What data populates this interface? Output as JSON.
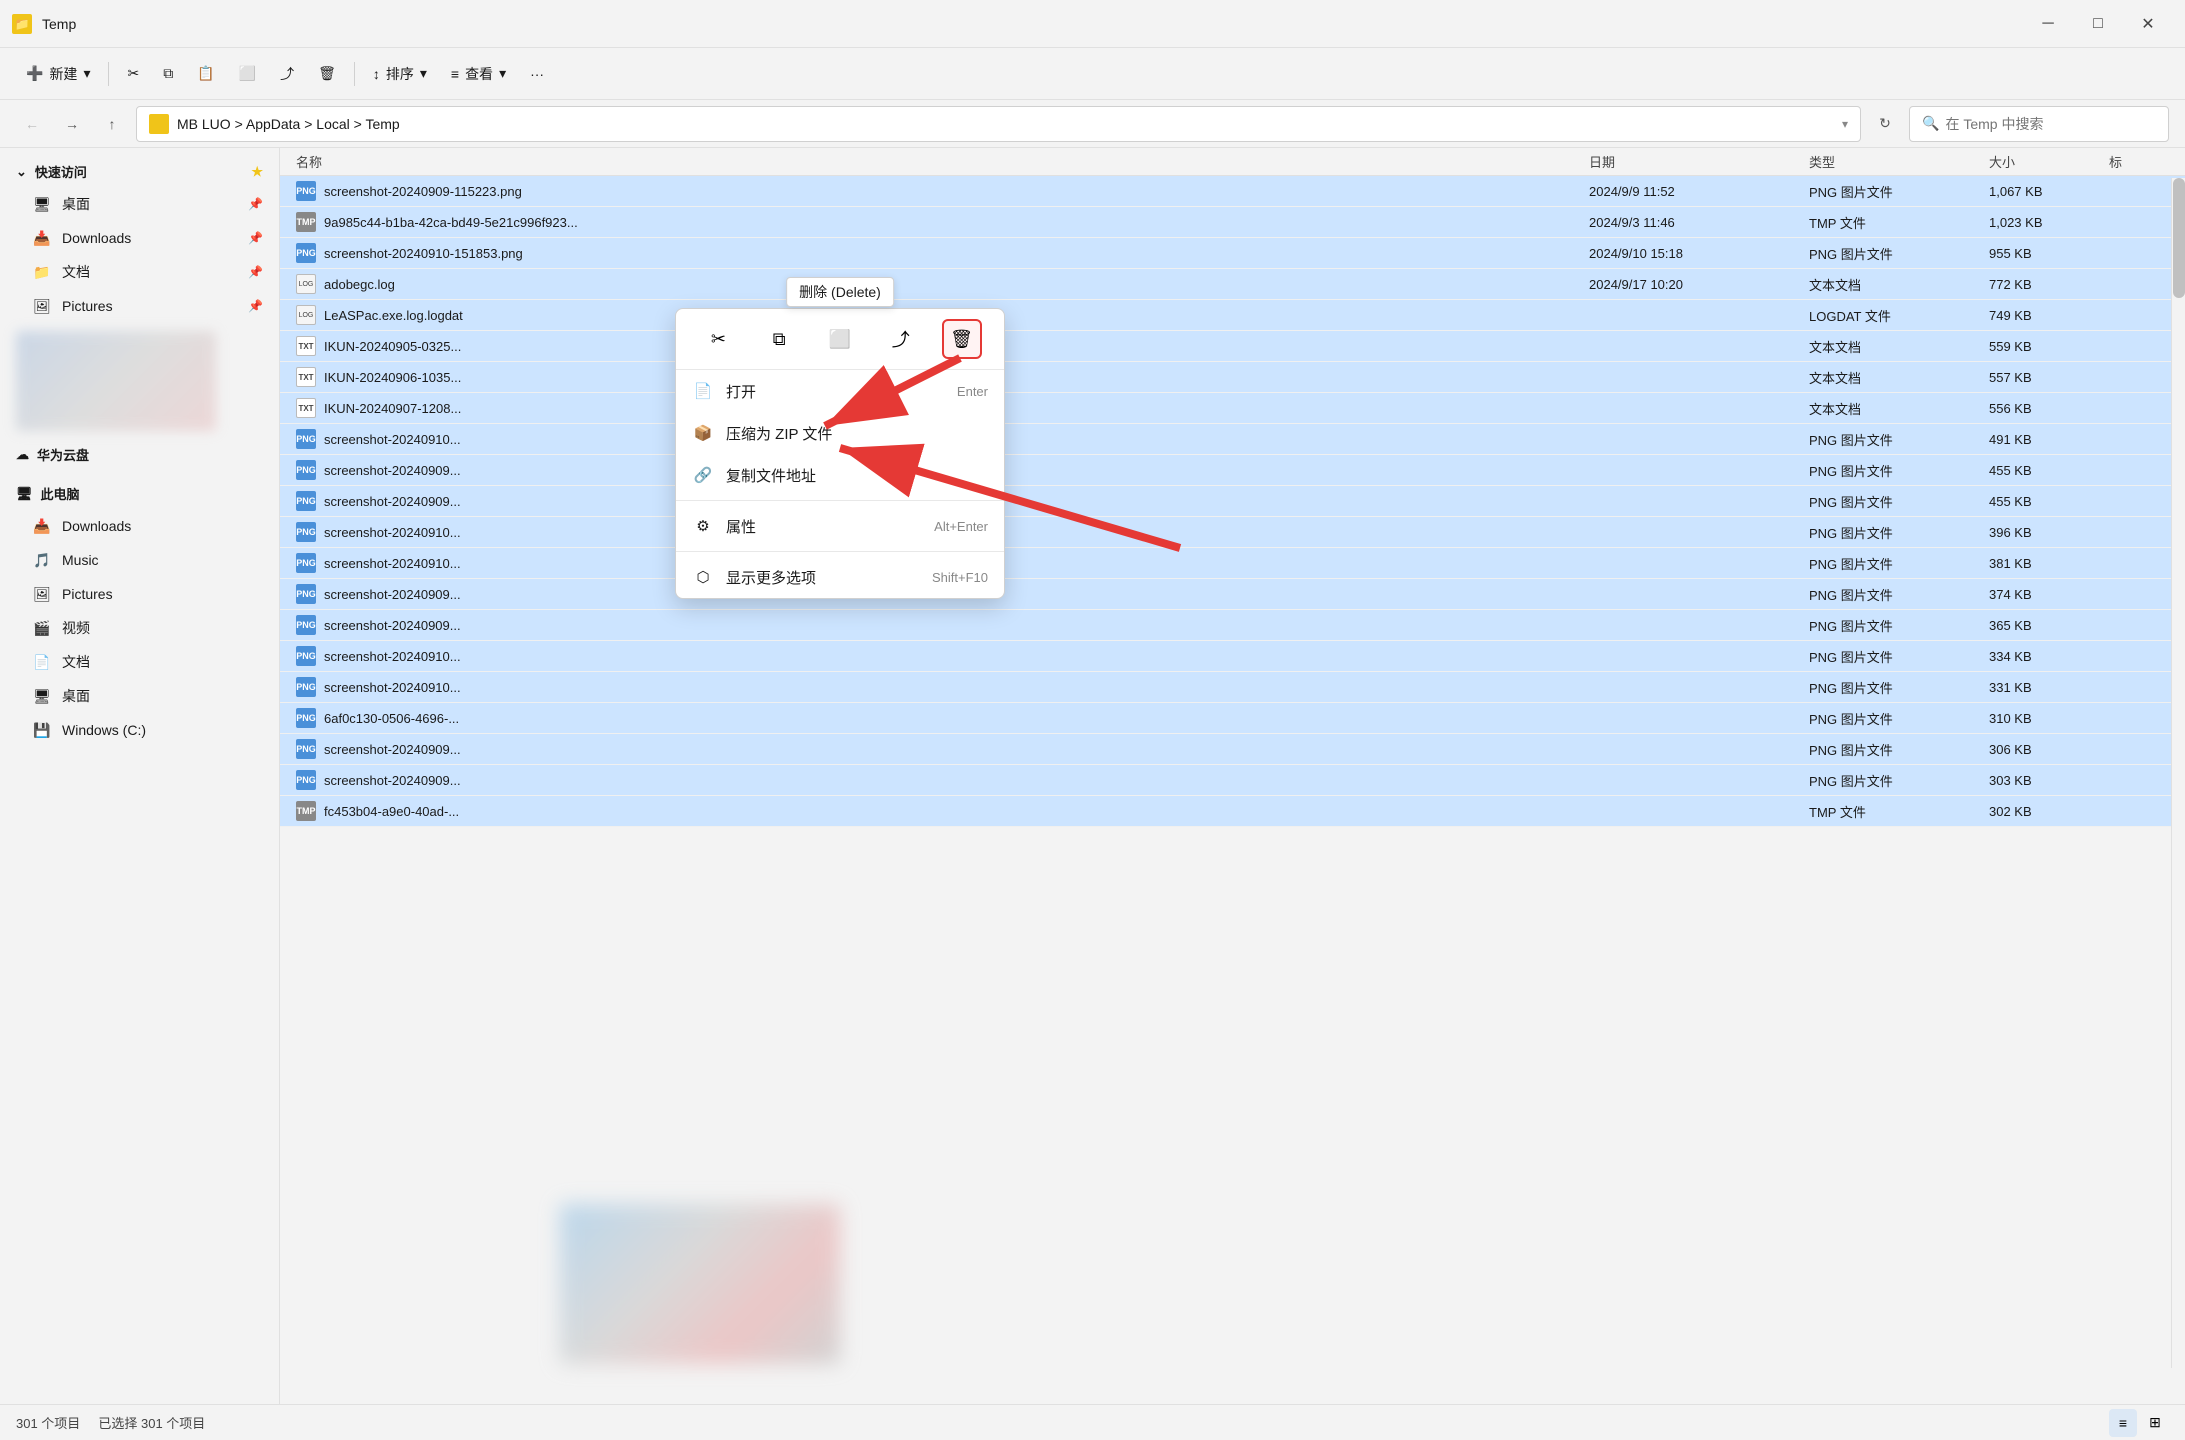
{
  "window": {
    "title": "Temp",
    "icon": "📁",
    "controls": {
      "minimize": "─",
      "maximize": "□",
      "close": "✕"
    }
  },
  "toolbar": {
    "new_label": "新建",
    "cut_label": "✂",
    "copy_label": "⧉",
    "paste_label": "📋",
    "rename_label": "⬜",
    "share_label": "⤴",
    "delete_label": "🗑",
    "sort_label": "排序",
    "view_label": "查看",
    "more_label": "···"
  },
  "address_bar": {
    "path": "MB LUO > AppData > Local > Temp",
    "refresh_icon": "↻",
    "search_placeholder": "在 Temp 中搜索"
  },
  "sidebar": {
    "quick_access_label": "快速访问",
    "items": [
      {
        "id": "desktop",
        "label": "桌面",
        "icon": "🖥",
        "pinned": true
      },
      {
        "id": "downloads",
        "label": "Downloads",
        "icon": "📥",
        "pinned": true,
        "active": false
      },
      {
        "id": "documents",
        "label": "文档",
        "icon": "📁",
        "pinned": true
      },
      {
        "id": "pictures",
        "label": "Pictures",
        "icon": "🖼",
        "pinned": true
      }
    ],
    "huawei_cloud_label": "华为云盘",
    "this_pc_label": "此电脑",
    "pc_items": [
      {
        "id": "pc-downloads",
        "label": "Downloads",
        "icon": "📥"
      },
      {
        "id": "pc-music",
        "label": "Music",
        "icon": "🎵"
      },
      {
        "id": "pc-pictures",
        "label": "Pictures",
        "icon": "🖼"
      },
      {
        "id": "pc-videos",
        "label": "视频",
        "icon": "🎬"
      },
      {
        "id": "pc-documents",
        "label": "文档",
        "icon": "📄"
      },
      {
        "id": "pc-desktop",
        "label": "桌面",
        "icon": "🖥"
      },
      {
        "id": "pc-windows",
        "label": "Windows (C:)",
        "icon": "💾"
      }
    ]
  },
  "file_list": {
    "headers": [
      "名称",
      "日期",
      "类型",
      "大小",
      "标"
    ],
    "files": [
      {
        "name": "screenshot-20240909-115223.png",
        "date": "2024/9/9 11:52",
        "type": "PNG 图片文件",
        "size": "1,067 KB",
        "icon": "png"
      },
      {
        "name": "9a985c44-b1ba-42ca-bd49-5e21c996f923...",
        "date": "2024/9/3 11:46",
        "type": "TMP 文件",
        "size": "1,023 KB",
        "icon": "tmp"
      },
      {
        "name": "screenshot-20240910-151853.png",
        "date": "2024/9/10 15:18",
        "type": "PNG 图片文件",
        "size": "955 KB",
        "icon": "png"
      },
      {
        "name": "adobegc.log",
        "date": "2024/9/17 10:20",
        "type": "文本文档",
        "size": "772 KB",
        "icon": "log"
      },
      {
        "name": "LeASPac.exe.log.logdat",
        "date": "",
        "type": "LOGDAT 文件",
        "size": "749 KB",
        "icon": "log"
      },
      {
        "name": "IKUN-20240905-0325...",
        "date": "",
        "type": "文本文档",
        "size": "559 KB",
        "icon": "txt"
      },
      {
        "name": "IKUN-20240906-1035...",
        "date": "",
        "type": "文本文档",
        "size": "557 KB",
        "icon": "txt"
      },
      {
        "name": "IKUN-20240907-1208...",
        "date": "",
        "type": "文本文档",
        "size": "556 KB",
        "icon": "txt"
      },
      {
        "name": "screenshot-20240910...",
        "date": "",
        "type": "PNG 图片文件",
        "size": "491 KB",
        "icon": "png"
      },
      {
        "name": "screenshot-20240909...",
        "date": "",
        "type": "PNG 图片文件",
        "size": "455 KB",
        "icon": "png"
      },
      {
        "name": "screenshot-20240909...",
        "date": "",
        "type": "PNG 图片文件",
        "size": "455 KB",
        "icon": "png"
      },
      {
        "name": "screenshot-20240910...",
        "date": "",
        "type": "PNG 图片文件",
        "size": "396 KB",
        "icon": "png"
      },
      {
        "name": "screenshot-20240910...",
        "date": "",
        "type": "PNG 图片文件",
        "size": "381 KB",
        "icon": "png"
      },
      {
        "name": "screenshot-20240909...",
        "date": "",
        "type": "PNG 图片文件",
        "size": "374 KB",
        "icon": "png"
      },
      {
        "name": "screenshot-20240909...",
        "date": "",
        "type": "PNG 图片文件",
        "size": "365 KB",
        "icon": "png"
      },
      {
        "name": "screenshot-20240910...",
        "date": "",
        "type": "PNG 图片文件",
        "size": "334 KB",
        "icon": "png"
      },
      {
        "name": "screenshot-20240910...",
        "date": "",
        "type": "PNG 图片文件",
        "size": "331 KB",
        "icon": "png"
      },
      {
        "name": "6af0c130-0506-4696-...",
        "date": "",
        "type": "PNG 图片文件",
        "size": "310 KB",
        "icon": "png"
      },
      {
        "name": "screenshot-20240909...",
        "date": "",
        "type": "PNG 图片文件",
        "size": "306 KB",
        "icon": "png"
      },
      {
        "name": "screenshot-20240909...",
        "date": "",
        "type": "PNG 图片文件",
        "size": "303 KB",
        "icon": "png"
      },
      {
        "name": "fc453b04-a9e0-40ad-...",
        "date": "",
        "type": "TMP 文件",
        "size": "302 KB",
        "icon": "tmp"
      }
    ]
  },
  "context_menu": {
    "delete_tooltip": "删除 (Delete)",
    "toolbar_buttons": [
      {
        "id": "cut",
        "icon": "✂",
        "label": "剪切"
      },
      {
        "id": "copy",
        "icon": "⧉",
        "label": "复制"
      },
      {
        "id": "paste-special",
        "icon": "⬜",
        "label": "粘贴"
      },
      {
        "id": "share",
        "icon": "⤴",
        "label": "共享"
      },
      {
        "id": "delete",
        "icon": "🗑",
        "label": "删除",
        "highlighted": true
      }
    ],
    "items": [
      {
        "id": "open",
        "label": "打开",
        "icon": "📄",
        "shortcut": "Enter"
      },
      {
        "id": "compress",
        "label": "压缩为 ZIP 文件",
        "icon": "📦",
        "shortcut": ""
      },
      {
        "id": "copy-path",
        "label": "复制文件地址",
        "icon": "🔗",
        "shortcut": ""
      },
      {
        "id": "properties",
        "label": "属性",
        "icon": "⚙",
        "shortcut": "Alt+Enter"
      }
    ],
    "more_options": "显示更多选项",
    "more_shortcut": "Shift+F10"
  },
  "status_bar": {
    "item_count": "301 个项目",
    "selected_count": "已选择 301 个项目"
  }
}
